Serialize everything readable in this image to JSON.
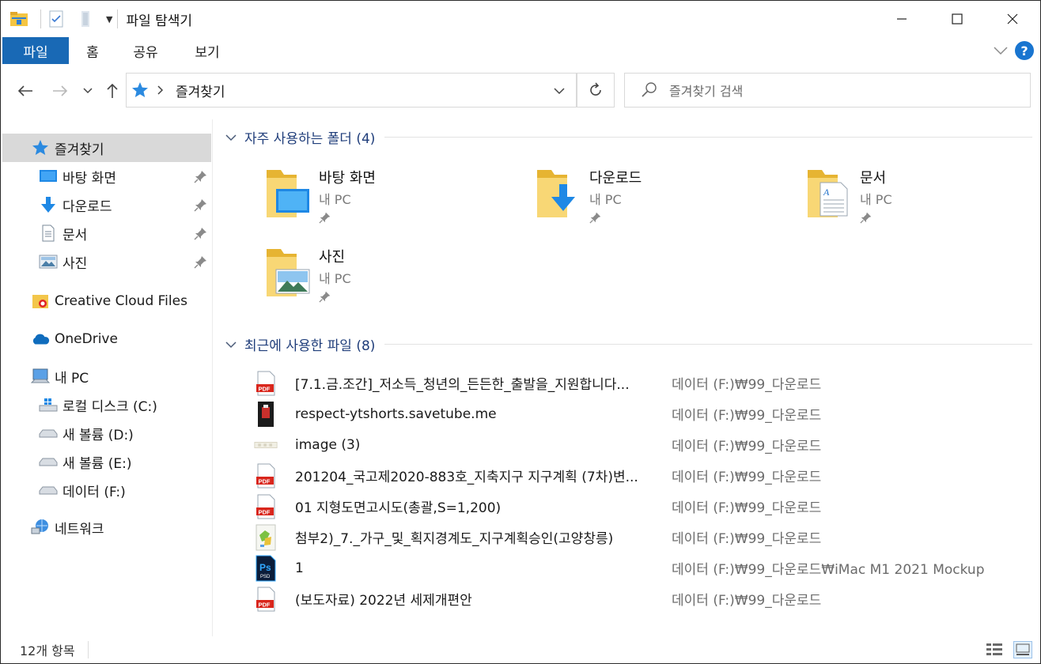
{
  "window": {
    "title": "파일 탐색기"
  },
  "ribbon": {
    "tabs": [
      {
        "label": "파일"
      },
      {
        "label": "홈"
      },
      {
        "label": "공유"
      },
      {
        "label": "보기"
      }
    ]
  },
  "address": {
    "path": "즐겨찾기",
    "search_placeholder": "즐겨찾기 검색"
  },
  "sidebar": {
    "items": [
      {
        "label": "즐겨찾기",
        "icon": "star-icon"
      },
      {
        "label": "바탕 화면",
        "icon": "desktop-icon",
        "pinned": true
      },
      {
        "label": "다운로드",
        "icon": "download-arrow-icon",
        "pinned": true
      },
      {
        "label": "문서",
        "icon": "document-icon",
        "pinned": true
      },
      {
        "label": "사진",
        "icon": "picture-icon",
        "pinned": true
      },
      {
        "label": "Creative Cloud Files",
        "icon": "creative-cloud-folder-icon"
      },
      {
        "label": "OneDrive",
        "icon": "cloud-icon"
      },
      {
        "label": "내 PC",
        "icon": "computer-icon"
      },
      {
        "label": "로컬 디스크 (C:)",
        "icon": "system-drive-icon"
      },
      {
        "label": "새 볼륨 (D:)",
        "icon": "drive-icon"
      },
      {
        "label": "새 볼륨 (E:)",
        "icon": "drive-icon"
      },
      {
        "label": "데이터 (F:)",
        "icon": "drive-icon"
      },
      {
        "label": "네트워크",
        "icon": "network-icon"
      }
    ]
  },
  "frequent": {
    "header": "자주 사용하는 폴더 (4)",
    "folders": [
      {
        "name": "바탕 화면",
        "location": "내 PC",
        "icon": "desktop-folder-icon"
      },
      {
        "name": "다운로드",
        "location": "내 PC",
        "icon": "downloads-folder-icon"
      },
      {
        "name": "문서",
        "location": "내 PC",
        "icon": "documents-folder-icon"
      },
      {
        "name": "사진",
        "location": "내 PC",
        "icon": "pictures-folder-icon"
      }
    ]
  },
  "recent": {
    "header": "최근에 사용한 파일 (8)",
    "files": [
      {
        "name": "[7.1.금.조간]_저소득_청년의_든든한_출발을_지원합니다...",
        "location": "데이터 (F:)₩99_다운로드",
        "icon": "pdf-icon"
      },
      {
        "name": "respect-ytshorts.savetube.me",
        "location": "데이터 (F:)₩99_다운로드",
        "icon": "video-thumbnail-icon"
      },
      {
        "name": "image (3)",
        "location": "데이터 (F:)₩99_다운로드",
        "icon": "image-thumbnail-icon"
      },
      {
        "name": "201204_국고제2020-883호_지축지구 지구계획 (7차)변...",
        "location": "데이터 (F:)₩99_다운로드",
        "icon": "pdf-icon"
      },
      {
        "name": "01 지형도면고시도(총괄,S=1,200)",
        "location": "데이터 (F:)₩99_다운로드",
        "icon": "pdf-icon"
      },
      {
        "name": "첨부2)_7._가구_및_획지경계도_지구계획승인(고양창릉)",
        "location": "데이터 (F:)₩99_다운로드",
        "icon": "map-image-icon"
      },
      {
        "name": "1",
        "location": "데이터 (F:)₩99_다운로드₩iMac M1 2021 Mockup",
        "icon": "photoshop-file-icon"
      },
      {
        "name": "(보도자료) 2022년 세제개편안",
        "location": "데이터 (F:)₩99_다운로드",
        "icon": "pdf-icon"
      }
    ]
  },
  "status": {
    "item_count": "12개 항목"
  }
}
